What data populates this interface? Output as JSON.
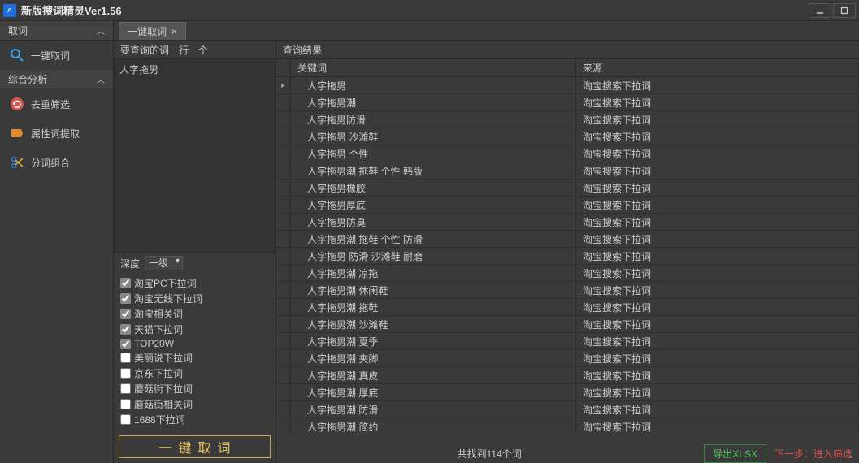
{
  "window": {
    "title": "新版搜词精灵Ver1.56"
  },
  "sidebar": {
    "sections": [
      {
        "header": "取词",
        "items": [
          {
            "label": "一键取词",
            "icon": "search"
          }
        ]
      },
      {
        "header": "综合分析",
        "items": [
          {
            "label": "去重筛选",
            "icon": "refresh"
          },
          {
            "label": "属性词提取",
            "icon": "tag"
          },
          {
            "label": "分词组合",
            "icon": "scissors"
          }
        ]
      }
    ]
  },
  "tabs": [
    {
      "label": "一键取词",
      "closable": true
    }
  ],
  "query": {
    "label": "要查询的词一行一个",
    "value": "人字拖男",
    "depth_label": "深度",
    "depth_value": "一级",
    "sources": [
      {
        "label": "淘宝PC下拉词",
        "checked": true
      },
      {
        "label": "淘宝无线下拉词",
        "checked": true
      },
      {
        "label": "淘宝相关词",
        "checked": true
      },
      {
        "label": "天猫下拉词",
        "checked": true
      },
      {
        "label": "TOP20W",
        "checked": true
      },
      {
        "label": "美丽说下拉词",
        "checked": false
      },
      {
        "label": "京东下拉词",
        "checked": false
      },
      {
        "label": "蘑菇街下拉词",
        "checked": false
      },
      {
        "label": "蘑菇街相关词",
        "checked": false
      },
      {
        "label": "1688下拉词",
        "checked": false
      }
    ],
    "fetch_button": "一键取词"
  },
  "results": {
    "label": "查询结果",
    "columns": {
      "keyword": "关键词",
      "source": "来源"
    },
    "rows": [
      {
        "keyword": "人字拖男",
        "source": "淘宝搜索下拉词",
        "current": true
      },
      {
        "keyword": "人字拖男潮",
        "source": "淘宝搜索下拉词"
      },
      {
        "keyword": "人字拖男防滑",
        "source": "淘宝搜索下拉词"
      },
      {
        "keyword": "人字拖男 沙滩鞋",
        "source": "淘宝搜索下拉词"
      },
      {
        "keyword": "人字拖男 个性",
        "source": "淘宝搜索下拉词"
      },
      {
        "keyword": "人字拖男潮 拖鞋 个性 韩版",
        "source": "淘宝搜索下拉词"
      },
      {
        "keyword": "人字拖男橡胶",
        "source": "淘宝搜索下拉词"
      },
      {
        "keyword": "人字拖男厚底",
        "source": "淘宝搜索下拉词"
      },
      {
        "keyword": "人字拖男防臭",
        "source": "淘宝搜索下拉词"
      },
      {
        "keyword": "人字拖男潮 拖鞋 个性 防滑",
        "source": "淘宝搜索下拉词"
      },
      {
        "keyword": "人字拖男 防滑 沙滩鞋 耐磨",
        "source": "淘宝搜索下拉词"
      },
      {
        "keyword": "人字拖男潮 凉拖",
        "source": "淘宝搜索下拉词"
      },
      {
        "keyword": "人字拖男潮 休闲鞋",
        "source": "淘宝搜索下拉词"
      },
      {
        "keyword": "人字拖男潮 拖鞋",
        "source": "淘宝搜索下拉词"
      },
      {
        "keyword": "人字拖男潮 沙滩鞋",
        "source": "淘宝搜索下拉词"
      },
      {
        "keyword": "人字拖男潮 夏季",
        "source": "淘宝搜索下拉词"
      },
      {
        "keyword": "人字拖男潮 夹脚",
        "source": "淘宝搜索下拉词"
      },
      {
        "keyword": "人字拖男潮 真皮",
        "source": "淘宝搜索下拉词"
      },
      {
        "keyword": "人字拖男潮 厚底",
        "source": "淘宝搜索下拉词"
      },
      {
        "keyword": "人字拖男潮 防滑",
        "source": "淘宝搜索下拉词"
      },
      {
        "keyword": "人字拖男潮 简约",
        "source": "淘宝搜索下拉词"
      }
    ],
    "status_count": "共找到114个词",
    "export_button": "导出XLSX",
    "next_step": "下一步：进入筛选"
  }
}
